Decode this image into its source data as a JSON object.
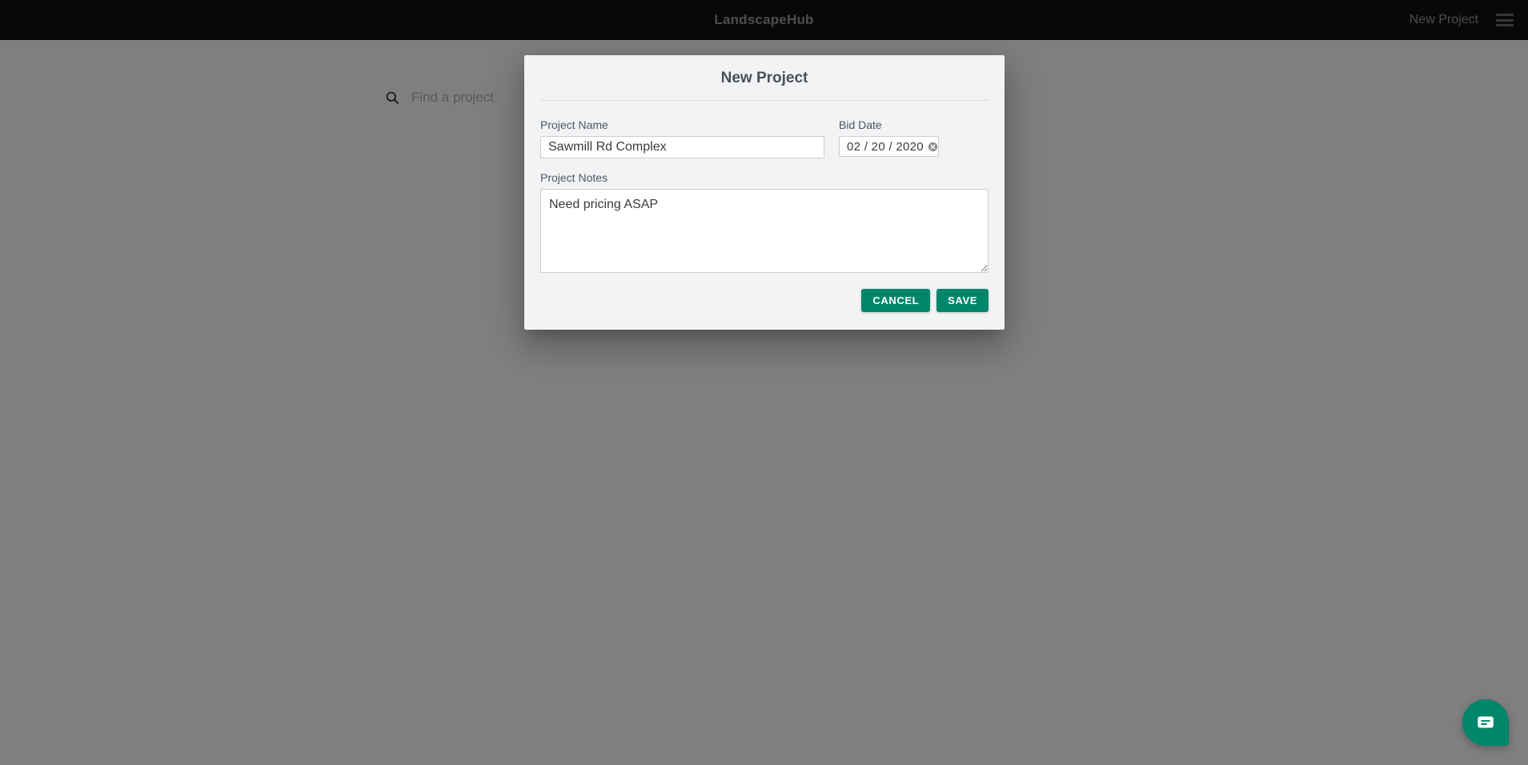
{
  "header": {
    "brand": "LandscapeHub",
    "new_project_link": "New Project",
    "menu_icon": "hamburger-menu-icon",
    "background_color": "#111111",
    "text_color": "#9b9b9b"
  },
  "page": {
    "search": {
      "icon": "search-icon",
      "placeholder": "Find a project",
      "value": ""
    }
  },
  "modal": {
    "title": "New Project",
    "fields": {
      "project_name": {
        "label": "Project Name",
        "value": "Sawmill Rd Complex",
        "placeholder": ""
      },
      "bid_date": {
        "label": "Bid Date",
        "value": "02 / 20 / 2020",
        "clear_icon": "clear-circle-icon"
      },
      "project_notes": {
        "label": "Project Notes",
        "value": "Need pricing ASAP",
        "placeholder": ""
      }
    },
    "actions": {
      "cancel_label": "CANCEL",
      "save_label": "SAVE"
    },
    "accent_color": "#00866b",
    "surface_color": "#f2f3f5"
  },
  "chat": {
    "icon": "chat-bubble-icon",
    "color": "#00866b"
  },
  "overlay": {
    "color": "#7b7b7d"
  }
}
